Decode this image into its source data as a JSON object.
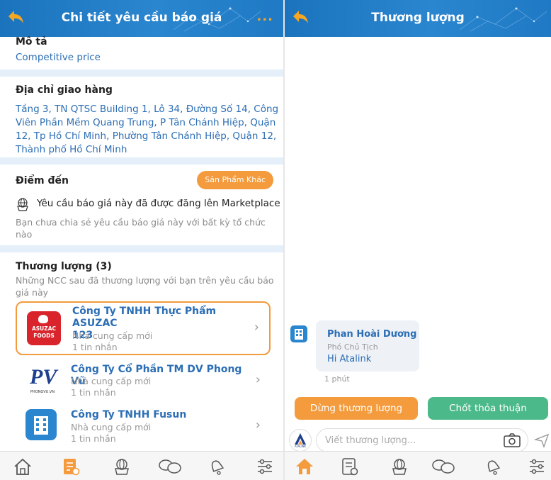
{
  "left_screen": {
    "header": {
      "title": "Chi tiết yêu cầu báo giá",
      "more_label": "..."
    },
    "description": {
      "label": "Mô tả",
      "value": "Competitive price"
    },
    "delivery": {
      "label": "Địa chỉ giao hàng",
      "lines": [
        "Tầng 3, TN QTSC Building 1, Lô 34, Đường Số 14, Công",
        "Viên Phần Mềm Quang Trung, P Tân Chánh Hiệp, Quận",
        "12, Tp Hồ Chí Minh, Phường Tân Chánh Hiệp, Quận 12,",
        "Thành phố Hồ Chí Minh"
      ]
    },
    "destination": {
      "label": "Điểm đến",
      "pill_label": "Sản Phẩm Khác",
      "marketplace_text": "Yêu cầu báo giá này đã được đăng lên Marketplace",
      "note_lines": [
        "Bạn chưa chia sẻ yêu cầu báo giá này với bất kỳ tổ chức",
        "nào"
      ]
    },
    "negotiation": {
      "label": "Thương lượng (3)",
      "note_lines": [
        "Những NCC sau đã thương lượng với bạn trên yêu cầu báo",
        "giá này"
      ],
      "suppliers": [
        {
          "name_line1": "Công Ty TNHH Thực Phẩm ASUZAC",
          "name_line2": "123",
          "role": "Nhà cung cấp mới",
          "messages": "1 tin nhắn",
          "logo_text1": "ASUZAC",
          "logo_text2": "FOODS"
        },
        {
          "name_line1": "Công Ty Cổ Phần TM DV Phong Vũ",
          "name_line2": "",
          "role": "Nhà cung cấp mới",
          "messages": "1 tin nhắn",
          "logo_text1": "PV",
          "logo_text2": "PHONGVU.VN"
        },
        {
          "name_line1": "Công Ty TNHH Fusun",
          "name_line2": "",
          "role": "Nhà cung cấp mới",
          "messages": "1 tin nhắn"
        }
      ]
    }
  },
  "right_screen": {
    "header": {
      "title": "Thương lượng"
    },
    "message": {
      "sender": "Phan Hoài Dương",
      "role": "Phó Chủ Tịch",
      "text": "Hi Atalink",
      "time": "1 phút"
    },
    "buttons": {
      "stop": "Dừng thương lượng",
      "close": "Chốt thỏa thuận"
    },
    "composer": {
      "placeholder": "Viết thương lượng...",
      "logo_text": "ATALINK"
    }
  },
  "colors": {
    "header_blue": "#1b73bd",
    "accent_orange": "#f39b3d",
    "accent_green": "#4cb98a",
    "text_blue": "#2c6eb5"
  }
}
